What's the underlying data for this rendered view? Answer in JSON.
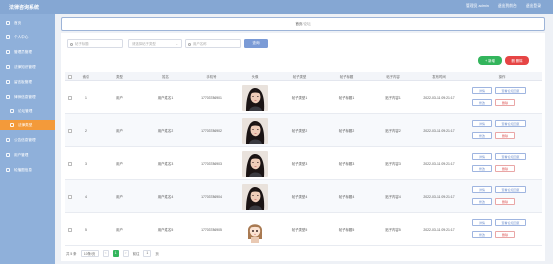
{
  "app": {
    "title": "法律咨询系统",
    "topbar_links": [
      "管理员 admin",
      "退出到前台",
      "退出登录"
    ]
  },
  "sidebar": {
    "items": [
      {
        "label": "首页",
        "sub": false,
        "active": false
      },
      {
        "label": "个人中心",
        "sub": false,
        "active": false
      },
      {
        "label": "管理员管理",
        "sub": false,
        "active": false
      },
      {
        "label": "法律知识管理",
        "sub": false,
        "active": false
      },
      {
        "label": "留言板管理",
        "sub": false,
        "active": false
      },
      {
        "label": "律师信息管理",
        "sub": false,
        "active": false
      },
      {
        "label": "论坛管理",
        "sub": true,
        "active": false
      },
      {
        "label": "法律类型",
        "sub": true,
        "active": true
      },
      {
        "label": "公告信息管理",
        "sub": false,
        "active": false
      },
      {
        "label": "用户管理",
        "sub": false,
        "active": false
      },
      {
        "label": "轮播图信息",
        "sub": false,
        "active": false
      }
    ]
  },
  "breadcrumb": {
    "home": "首页",
    "sep": " / ",
    "current": "论坛"
  },
  "search": {
    "field1_placeholder": "帖子标题",
    "field2_placeholder": "请选择帖子类型",
    "field3_placeholder": "用户名称",
    "query_label": "查询"
  },
  "actions": {
    "add_label": "+ 新增",
    "delete_label": "删 删除"
  },
  "table": {
    "headers": [
      "",
      "索引",
      "类型",
      "姓名",
      "手机号",
      "头像",
      "帖子类型",
      "帖子标题",
      "帖子内容",
      "发布时间",
      "操作"
    ],
    "rows": [
      {
        "index": "1",
        "type": "用户",
        "name": "用户姓名1",
        "phone": "17703786901",
        "post_type": "帖子类型1",
        "post_title": "帖子标题1",
        "content": "贴子内容1",
        "time": "2022-03-11 09:21:17",
        "avatar": "photo"
      },
      {
        "index": "2",
        "type": "用户",
        "name": "用户姓名2",
        "phone": "17703786902",
        "post_type": "帖子类型2",
        "post_title": "帖子标题2",
        "content": "贴子内容2",
        "time": "2022-03-11 09:21:17",
        "avatar": "photo"
      },
      {
        "index": "3",
        "type": "用户",
        "name": "用户姓名3",
        "phone": "17703786903",
        "post_type": "帖子类型3",
        "post_title": "帖子标题3",
        "content": "贴子内容3",
        "time": "2022-03-11 09:21:17",
        "avatar": "photo"
      },
      {
        "index": "4",
        "type": "用户",
        "name": "用户姓名4",
        "phone": "17703786904",
        "post_type": "帖子类型4",
        "post_title": "帖子标题4",
        "content": "贴子内容4",
        "time": "2022-03-11 09:21:17",
        "avatar": "photo"
      },
      {
        "index": "5",
        "type": "用户",
        "name": "用户姓名5",
        "phone": "17703786905",
        "post_type": "帖子类型5",
        "post_title": "帖子标题5",
        "content": "贴子内容5",
        "time": "2022-03-11 09:21:17",
        "avatar": "cartoon"
      }
    ],
    "op_labels": {
      "detail": "详情",
      "reply": "查看论坛回复",
      "edit": "修改",
      "delete": "删除"
    }
  },
  "pager": {
    "total": "共 5 条",
    "size": "10条/页",
    "prev": "<",
    "current": "1",
    "next": ">",
    "goto": "前往",
    "page": "1",
    "unit": "页"
  }
}
